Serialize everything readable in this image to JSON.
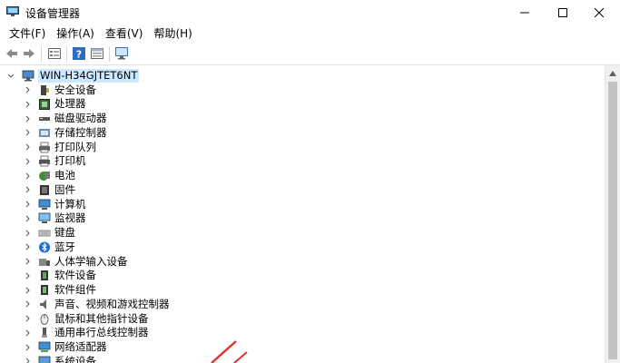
{
  "window": {
    "title": "设备管理器",
    "minimize_icon": "minimize-icon",
    "maximize_icon": "maximize-icon",
    "close_icon": "close-icon"
  },
  "menu": [
    "文件(F)",
    "操作(A)",
    "查看(V)",
    "帮助(H)"
  ],
  "toolbar": {
    "buttons": [
      "back-arrow-icon",
      "forward-arrow-icon",
      "properties-icon",
      "help-icon",
      "details-icon",
      "monitor-scan-icon"
    ]
  },
  "tree": {
    "root": "WIN-H34GJTET6NT",
    "items": [
      {
        "label": "安全设备",
        "icon": "security-device-icon"
      },
      {
        "label": "处理器",
        "icon": "processor-icon"
      },
      {
        "label": "磁盘驱动器",
        "icon": "disk-drive-icon"
      },
      {
        "label": "存储控制器",
        "icon": "storage-controller-icon"
      },
      {
        "label": "打印队列",
        "icon": "print-queue-icon"
      },
      {
        "label": "打印机",
        "icon": "printer-icon"
      },
      {
        "label": "电池",
        "icon": "battery-icon"
      },
      {
        "label": "固件",
        "icon": "firmware-icon"
      },
      {
        "label": "计算机",
        "icon": "computer-icon"
      },
      {
        "label": "监视器",
        "icon": "monitor-icon"
      },
      {
        "label": "键盘",
        "icon": "keyboard-icon"
      },
      {
        "label": "蓝牙",
        "icon": "bluetooth-icon"
      },
      {
        "label": "人体学输入设备",
        "icon": "hid-icon"
      },
      {
        "label": "软件设备",
        "icon": "software-device-icon"
      },
      {
        "label": "软件组件",
        "icon": "software-component-icon"
      },
      {
        "label": "声音、视频和游戏控制器",
        "icon": "sound-icon"
      },
      {
        "label": "鼠标和其他指针设备",
        "icon": "mouse-icon"
      },
      {
        "label": "通用串行总线控制器",
        "icon": "usb-icon"
      },
      {
        "label": "网络适配器",
        "icon": "network-adapter-icon"
      },
      {
        "label": "系统设备",
        "icon": "system-device-icon"
      }
    ]
  },
  "colors": {
    "selection": "#cde8ff",
    "accent": "#0078d7",
    "annotation_arrow": "#e0312a"
  }
}
